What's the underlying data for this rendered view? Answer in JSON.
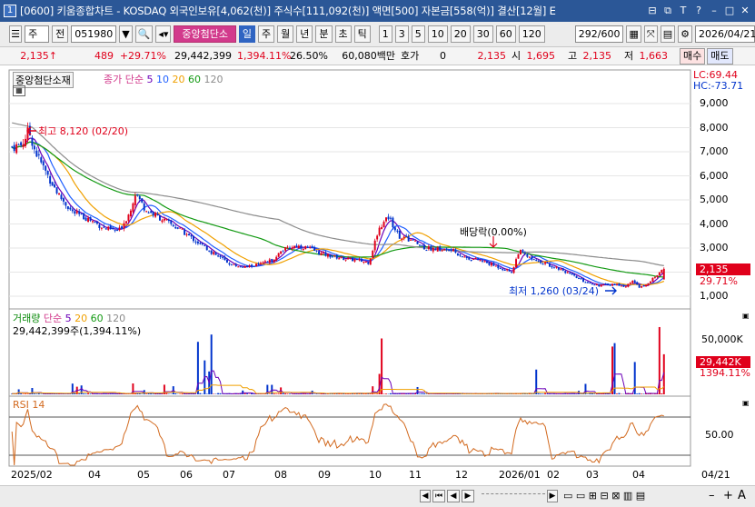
{
  "title": {
    "text": "[0600] 키움종합차트 - KOSDAQ 외국인보유[4,062(천)] 주식수[111,092(천)] 액면[500] 자본금[558(억)] 결산[12월] E"
  },
  "toolbar": {
    "type_label": "주",
    "prev_label": "전",
    "code": "051980",
    "stock_name": "중앙첨단소",
    "periods": [
      "일",
      "주",
      "월",
      "년",
      "분",
      "초",
      "틱"
    ],
    "minutes": [
      "1",
      "3",
      "5",
      "10",
      "20",
      "30",
      "60",
      "120"
    ],
    "count": "292/600",
    "date": "2026/04/21"
  },
  "quote": {
    "price": "2,135",
    "change": "489",
    "change_pct": "+29.71%",
    "volume": "29,442,399",
    "volume_pct": "1,394.11%",
    "turnover": "26.50%",
    "amount": "60,080백만",
    "hoga_label": "호가",
    "hoga_value": "0",
    "ask": "2,135",
    "open_label": "시",
    "open": "1,695",
    "high_label": "고",
    "high": "2,135",
    "low_label": "저",
    "low": "1,663",
    "buy_label": "매수",
    "sell_label": "매도"
  },
  "price_panel": {
    "stock_label": "중앙첨단소재",
    "ma_label": "종가 단순",
    "ma_periods": [
      "5",
      "10",
      "20",
      "60",
      "120"
    ],
    "lc": "LC:69.44",
    "hc": "HC:-73.71",
    "y_ticks": [
      "9,000",
      "8,000",
      "7,000",
      "6,000",
      "5,000",
      "4,000",
      "3,000",
      "2,000",
      "1,000"
    ],
    "last_price": "2,135",
    "last_pct": "29.71%",
    "high_note": "최고 8,120 (02/20)",
    "low_note": "최저 1,260 (03/24)",
    "dividend_note": "배당락(0.00%)"
  },
  "volume_panel": {
    "label": "거래량",
    "ma_label": "단순",
    "ma_periods": [
      "5",
      "20",
      "60",
      "120"
    ],
    "value_text": "29,442,399주(1,394.11%)",
    "y_tick": "50,000K",
    "last_value": "29,442K",
    "last_pct": "1394.11%"
  },
  "rsi_panel": {
    "label": "RSI 14",
    "y_tick": "50.00"
  },
  "x_labels": [
    "2025/02",
    "04",
    "05",
    "06",
    "07",
    "08",
    "09",
    "10",
    "11",
    "12",
    "2026/01",
    "02",
    "03",
    "04",
    "04/21"
  ],
  "colors": {
    "up": "#e0001b",
    "down": "#0033cc",
    "ma5": "#6b00b8",
    "ma10": "#2060ff",
    "ma20": "#f0a000",
    "ma60": "#139a13",
    "ma120": "#8c8c8c"
  }
}
